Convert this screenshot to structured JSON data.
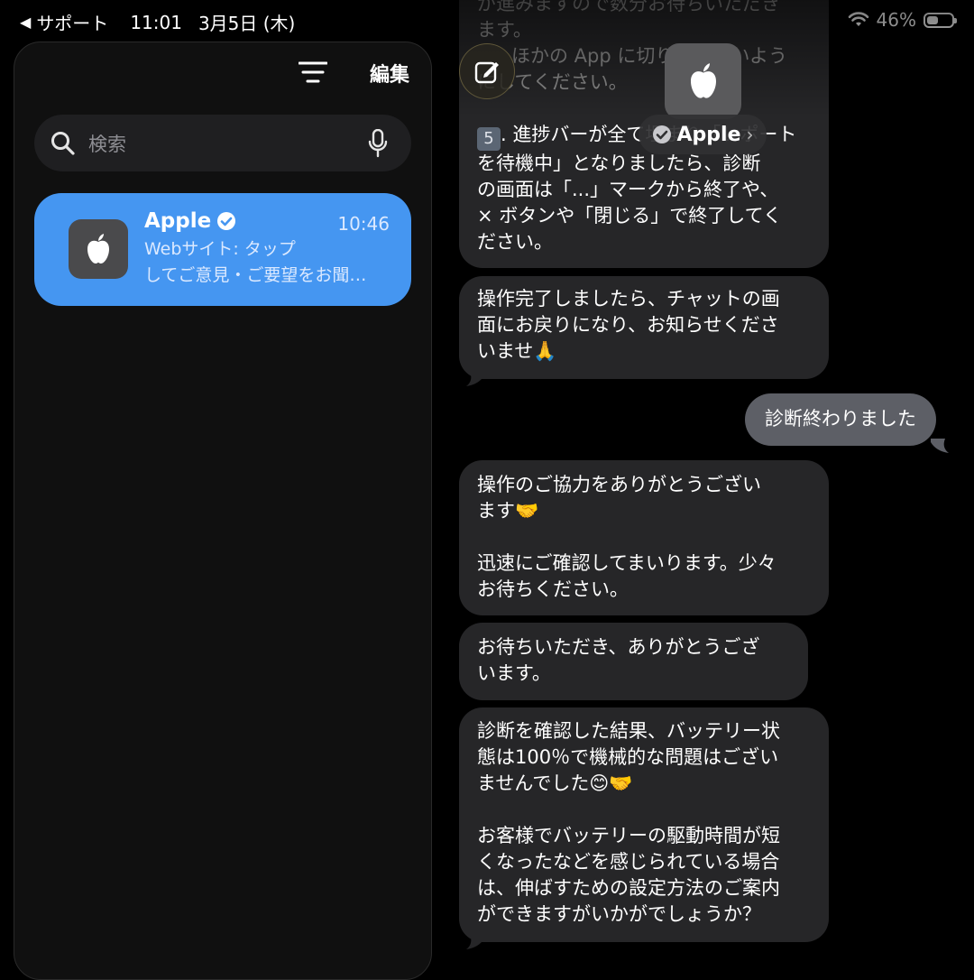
{
  "status_bar": {
    "back_label": "サポート",
    "time": "11:01",
    "date": "3月5日 (木)",
    "battery": "46%",
    "battery_level": 0.46
  },
  "sidebar": {
    "edit_label": "編集",
    "search": {
      "placeholder": "検索"
    },
    "chat": {
      "name": "Apple",
      "time": "10:46",
      "preview_line1": "Webサイト: タップ",
      "preview_line2": "してご意見・ご要望をお聞…"
    }
  },
  "header": {
    "contact_name": "Apple",
    "chevron": "›"
  },
  "messages": {
    "m0": {
      "line1": "が進みますので数分お待ちいただき",
      "line2": "ます。",
      "line3": "ほかの App に切り替えないよう",
      "line4": "にしてください。",
      "step_badge": "5",
      "line5": ". 進捗バーが全て埋まり「レポート",
      "line6": "を待機中」となりましたら、診断",
      "line7": "の画面は「...」マークから終了や、",
      "line8": "× ボタンや「閉じる」で終了してく",
      "line9": "ださい。"
    },
    "m1": {
      "line1": "操作完了しましたら、チャットの画",
      "line2": "面にお戻りになり、お知らせくださ",
      "line3": "いませ🙏"
    },
    "m2": {
      "text": "診断終わりました"
    },
    "m3": {
      "line1": "操作のご協力をありがとうござい",
      "line2": "ます🤝",
      "line3": "迅速にご確認してまいります。少々",
      "line4": "お待ちください。"
    },
    "m4": {
      "line1": "お待ちいただき、ありがとうござ",
      "line2": "います。"
    },
    "m5": {
      "line1": "診断を確認した結果、バッテリー状",
      "line2": "態は100％で機械的な問題はござい",
      "line3": "ませんでした😊🤝",
      "line4": "お客様でバッテリーの駆動時間が短",
      "line5": "くなったなどを感じられている場合",
      "line6": "は、伸ばすための設定方法のご案内",
      "line7": "ができますがいかがでしょうか？"
    }
  },
  "colors": {
    "background": "#000000",
    "sidebar_bg": "#101010",
    "selected_chat": "#4596f1",
    "incoming_bubble": "#262628",
    "outgoing_bubble": "#5d5f66"
  },
  "icons": [
    "back-arrow-icon",
    "wifi-icon",
    "battery-icon",
    "filter-icon",
    "search-icon",
    "mic-icon",
    "apple-logo-icon",
    "verified-badge-icon",
    "compose-icon"
  ]
}
